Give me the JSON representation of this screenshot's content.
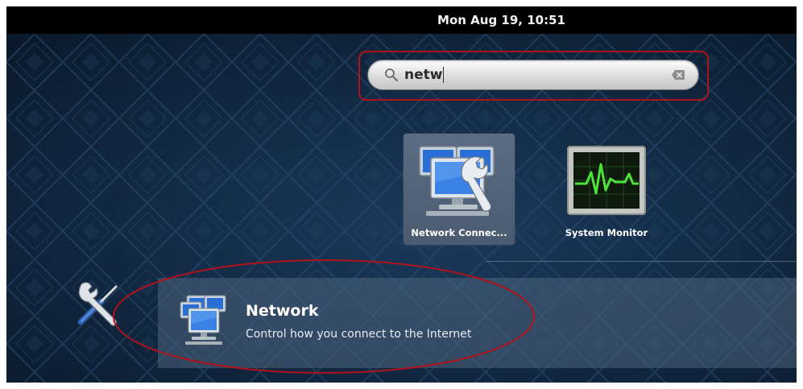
{
  "top_bar": {
    "clock": "Mon Aug 19, 10:51"
  },
  "search": {
    "value": "netw",
    "search_icon": "search-icon",
    "clear_icon": "clear-text-icon"
  },
  "applications": [
    {
      "label": "Network Connec...",
      "icon": "network-connections-icon"
    },
    {
      "label": "System Monitor",
      "icon": "system-monitor-icon"
    }
  ],
  "settings_results": {
    "category_icon": "settings-tools-icon",
    "items": [
      {
        "title": "Network",
        "description": "Control how you connect to the Internet",
        "icon": "network-icon"
      }
    ]
  },
  "colors": {
    "background": "#0e2036",
    "top_bar": "#000000",
    "annotation": "#b0121b",
    "selected_tile": "#55677d",
    "result_row": "#3f546c"
  }
}
